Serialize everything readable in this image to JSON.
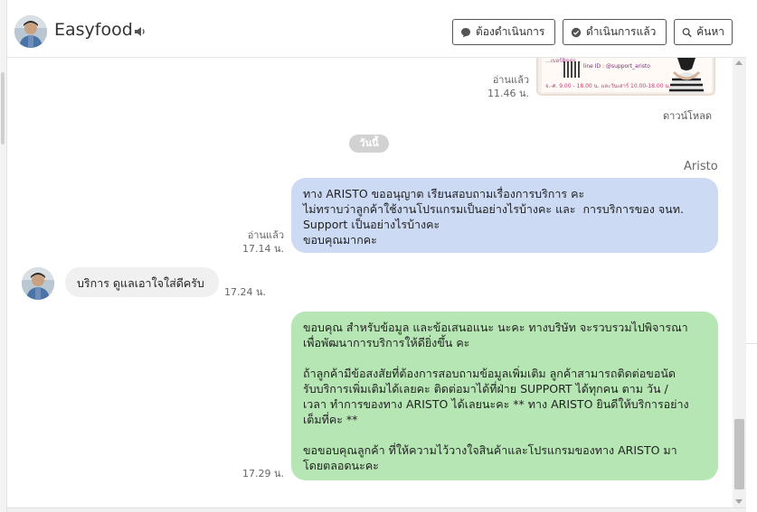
{
  "header": {
    "contact_name": "Easyfood",
    "buttons": {
      "pending": "ต้องดำเนินการ",
      "done": "ดำเนินการแล้ว",
      "search": "ค้นหา"
    }
  },
  "image_message": {
    "qr_caption": "line ID : @support_aristo",
    "phone_line": "...เบอร์ติดต่อ...",
    "hours": "จ.-ศ. 9.00 - 18.00 น. และวันเสาร์ 10.00-18.00 น.",
    "read_status": "อ่านแล้ว",
    "time": "11.46 น.",
    "download_label": "ดาวน์โหลด"
  },
  "date_separator": "วันนี้",
  "messages": [
    {
      "direction": "outgoing",
      "sender": "Aristo",
      "text": "ทาง ARISTO ขออนุญาต เรียนสอบถามเรื่องการบริการ คะ\nไม่ทราบว่าลูกค้าใช้งานโปรแกรมเป็นอย่างไรบ้างคะ และ  การบริการของ จนท.\nSupport เป็นอย่างไรบ้างคะ\nขอบคุณมากคะ",
      "read_status": "อ่านแล้ว",
      "time": "17.14 น."
    },
    {
      "direction": "incoming",
      "text": "บริการ ดูแลเอาใจใส่ดีครับ",
      "time": "17.24 น."
    },
    {
      "direction": "outgoing",
      "text": "ขอบคุณ สำหรับข้อมูล และข้อเสนอแนะ นะคะ ทางบริษัท จะรวบรวมไปพิจารณา\nเพื่อพัฒนาการบริการให้ดียิ่งขึ้น คะ\n\nถ้าลูกค้ามีข้อสงสัยที่ต้องการสอบถามข้อมูลเพิ่มเติม ลูกค้าสามารถติดต่อขอนัด\nรับบริการเพิ่มเติมได้เลยคะ ติดต่อมาได้ที่ฝ่าย SUPPORT ได้ทุกคน ตาม วัน /\nเวลา ทำการของทาง ARISTO ได้เลยนะคะ ** ทาง ARISTO ยินดีให้บริการอย่าง\nเต็มที่คะ **\n\nขอขอบคุณลูกค้า ที่ให้ความไว้วางใจสินค้าและโปรแกรมของทาง ARISTO มา\nโดยตลอดนะคะ",
      "time": "17.29 น."
    }
  ],
  "colors": {
    "outgoing_blue": "#ccdaf4",
    "outgoing_green": "#b6e6b3",
    "incoming_grey": "#f0f0f0",
    "date_pill": "#d2d2d2"
  },
  "icons": {
    "speaker": "speaker-icon",
    "pending": "chat-bubble-icon",
    "done": "chat-check-icon",
    "search": "search-icon"
  }
}
